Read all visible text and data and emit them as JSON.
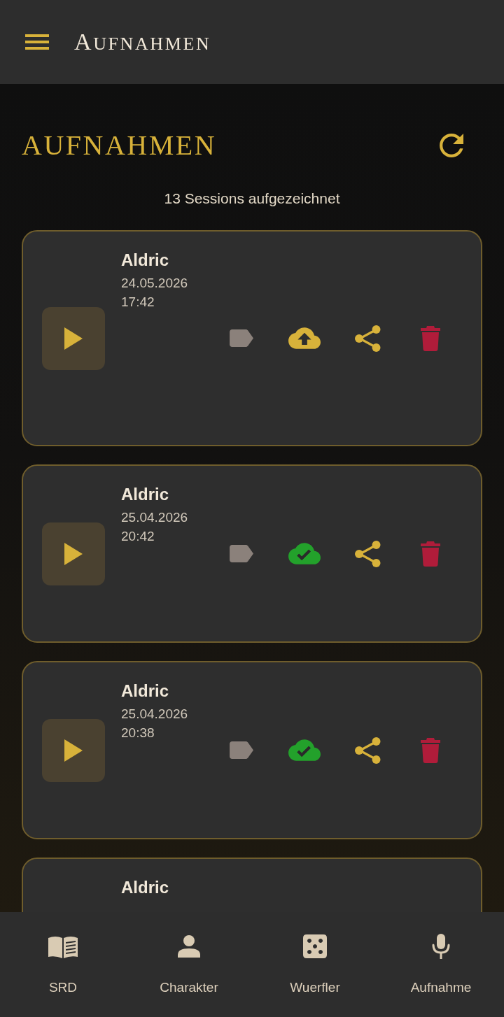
{
  "app_bar": {
    "title": "AUFNAHMEN"
  },
  "header": {
    "title": "AUFNAHMEN"
  },
  "summary": "13 Sessions aufgezeichnet",
  "recordings": [
    {
      "name": "Aldric",
      "date": "24.05.2026",
      "time": "17:42",
      "synced": false
    },
    {
      "name": "Aldric",
      "date": "25.04.2026",
      "time": "20:42",
      "synced": true
    },
    {
      "name": "Aldric",
      "date": "25.04.2026",
      "time": "20:38",
      "synced": true
    },
    {
      "name": "Aldric"
    }
  ],
  "bottom_nav": [
    {
      "label": "SRD"
    },
    {
      "label": "Charakter"
    },
    {
      "label": "Wuerfler"
    },
    {
      "label": "Aufnahme"
    }
  ]
}
